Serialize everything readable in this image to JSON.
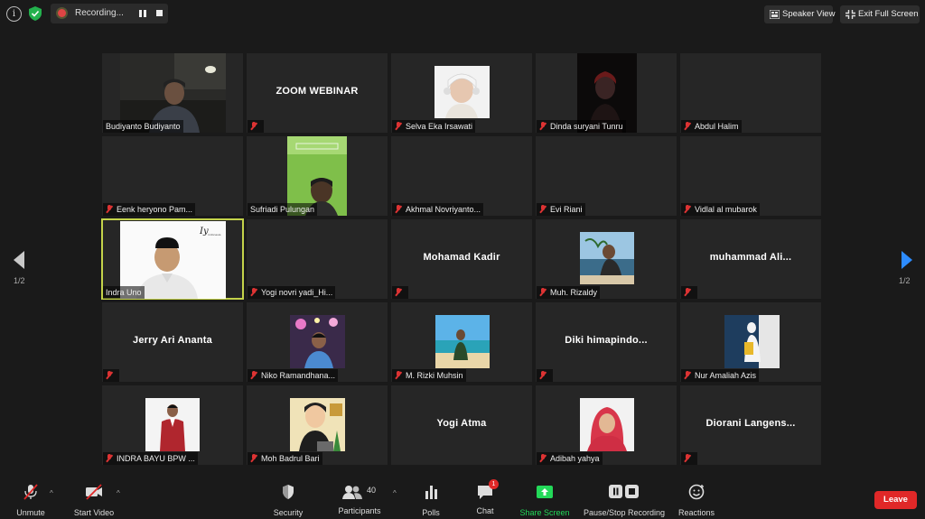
{
  "topbar": {
    "recording_label": "Recording...",
    "speaker_view_label": "Speaker View",
    "exit_full_screen_label": "Exit Full Screen"
  },
  "pagination": {
    "left_page": "1/2",
    "right_page": "1/2"
  },
  "tiles": [
    {
      "name": "Budiyanto Budiyanto",
      "muted": false,
      "display": "",
      "video": true
    },
    {
      "name": "",
      "muted": true,
      "display": "ZOOM WEBINAR",
      "video": false
    },
    {
      "name": "Selva Eka Irsawati",
      "muted": true,
      "display": "",
      "video": true
    },
    {
      "name": "Dinda suryani Tunru",
      "muted": true,
      "display": "",
      "video": true
    },
    {
      "name": "Abdul Halim",
      "muted": true,
      "display": "",
      "video": false
    },
    {
      "name": "Eenk heryono Pam...",
      "muted": true,
      "display": "",
      "video": false
    },
    {
      "name": "Sufriadi Pulungan",
      "muted": false,
      "display": "",
      "video": true
    },
    {
      "name": "Akhmal Novriyanto...",
      "muted": true,
      "display": "",
      "video": false
    },
    {
      "name": "Evi Riani",
      "muted": true,
      "display": "",
      "video": false
    },
    {
      "name": "Vidlal al mubarok",
      "muted": true,
      "display": "",
      "video": false
    },
    {
      "name": "Indra Uno",
      "muted": false,
      "display": "",
      "video": true,
      "active": true
    },
    {
      "name": "Yogi novri yadi_Hi...",
      "muted": true,
      "display": "",
      "video": false
    },
    {
      "name": "",
      "muted": true,
      "display": "Mohamad Kadir",
      "video": false
    },
    {
      "name": "Muh. Rizaldy",
      "muted": true,
      "display": "",
      "video": true
    },
    {
      "name": "",
      "muted": true,
      "display": "muhammad  Ali...",
      "video": false
    },
    {
      "name": "",
      "muted": true,
      "display": "Jerry Ari Ananta",
      "video": false
    },
    {
      "name": "Niko Ramandhana...",
      "muted": true,
      "display": "",
      "video": true
    },
    {
      "name": "M. Rizki Muhsin",
      "muted": true,
      "display": "",
      "video": true
    },
    {
      "name": "",
      "muted": true,
      "display": "Diki  himapindo...",
      "video": false
    },
    {
      "name": "Nur Amaliah Azis",
      "muted": true,
      "display": "",
      "video": true
    },
    {
      "name": "INDRA BAYU BPW ...",
      "muted": true,
      "display": "",
      "video": true
    },
    {
      "name": "Moh Badrul Bari",
      "muted": true,
      "display": "",
      "video": true
    },
    {
      "name": "",
      "muted": false,
      "display": "Yogi Atma",
      "video": false
    },
    {
      "name": "Adibah yahya",
      "muted": true,
      "display": "",
      "video": true
    },
    {
      "name": "",
      "muted": true,
      "display": "Diorani  Langens...",
      "video": false
    }
  ],
  "toolbar": {
    "unmute_label": "Unmute",
    "start_video_label": "Start Video",
    "security_label": "Security",
    "participants_label": "Participants",
    "participants_count": "40",
    "polls_label": "Polls",
    "chat_label": "Chat",
    "chat_badge": "1",
    "share_screen_label": "Share Screen",
    "pause_stop_label": "Pause/Stop Recording",
    "reactions_label": "Reactions",
    "leave_label": "Leave"
  },
  "colors": {
    "active_speaker_border": "#c4d34a",
    "share_screen_green": "#23d959",
    "leave_red": "#e02828",
    "nav_arrow_blue": "#2d8cff",
    "muted_mic_red": "#dd3333"
  }
}
